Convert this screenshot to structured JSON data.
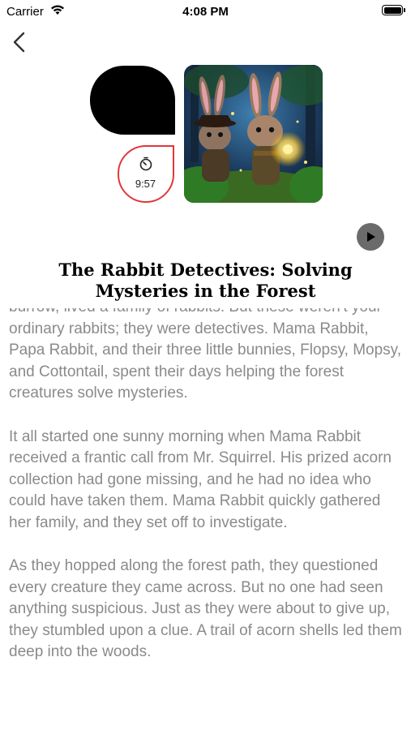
{
  "status_bar": {
    "carrier": "Carrier",
    "time": "4:08 PM"
  },
  "nav": {
    "back_icon": "chevron-left-icon"
  },
  "timer": {
    "icon": "timer-icon",
    "value": "9:57",
    "accent_color": "#e0383b"
  },
  "cover": {
    "icon": "rabbit-detectives-illustration"
  },
  "play": {
    "icon": "play-icon"
  },
  "story": {
    "title": "The Rabbit Detectives: Solving Mysteries in the Forest",
    "paragraphs": [
      "burrow, lived a family of rabbits. But these weren't your ordinary rabbits; they were detectives. Mama Rabbit, Papa Rabbit, and their three little bunnies, Flopsy, Mopsy, and Cottontail, spent their days helping the forest creatures solve mysteries.",
      "It all started one sunny morning when Mama Rabbit received a frantic call from Mr. Squirrel. His prized acorn collection had gone missing, and he had no idea who could have taken them. Mama Rabbit quickly gathered her family, and they set off to investigate.",
      "As they hopped along the forest path, they questioned every creature they came across. But no one had seen anything suspicious. Just as they were about to give up, they stumbled upon a clue. A trail of acorn shells led them deep into the woods."
    ]
  }
}
